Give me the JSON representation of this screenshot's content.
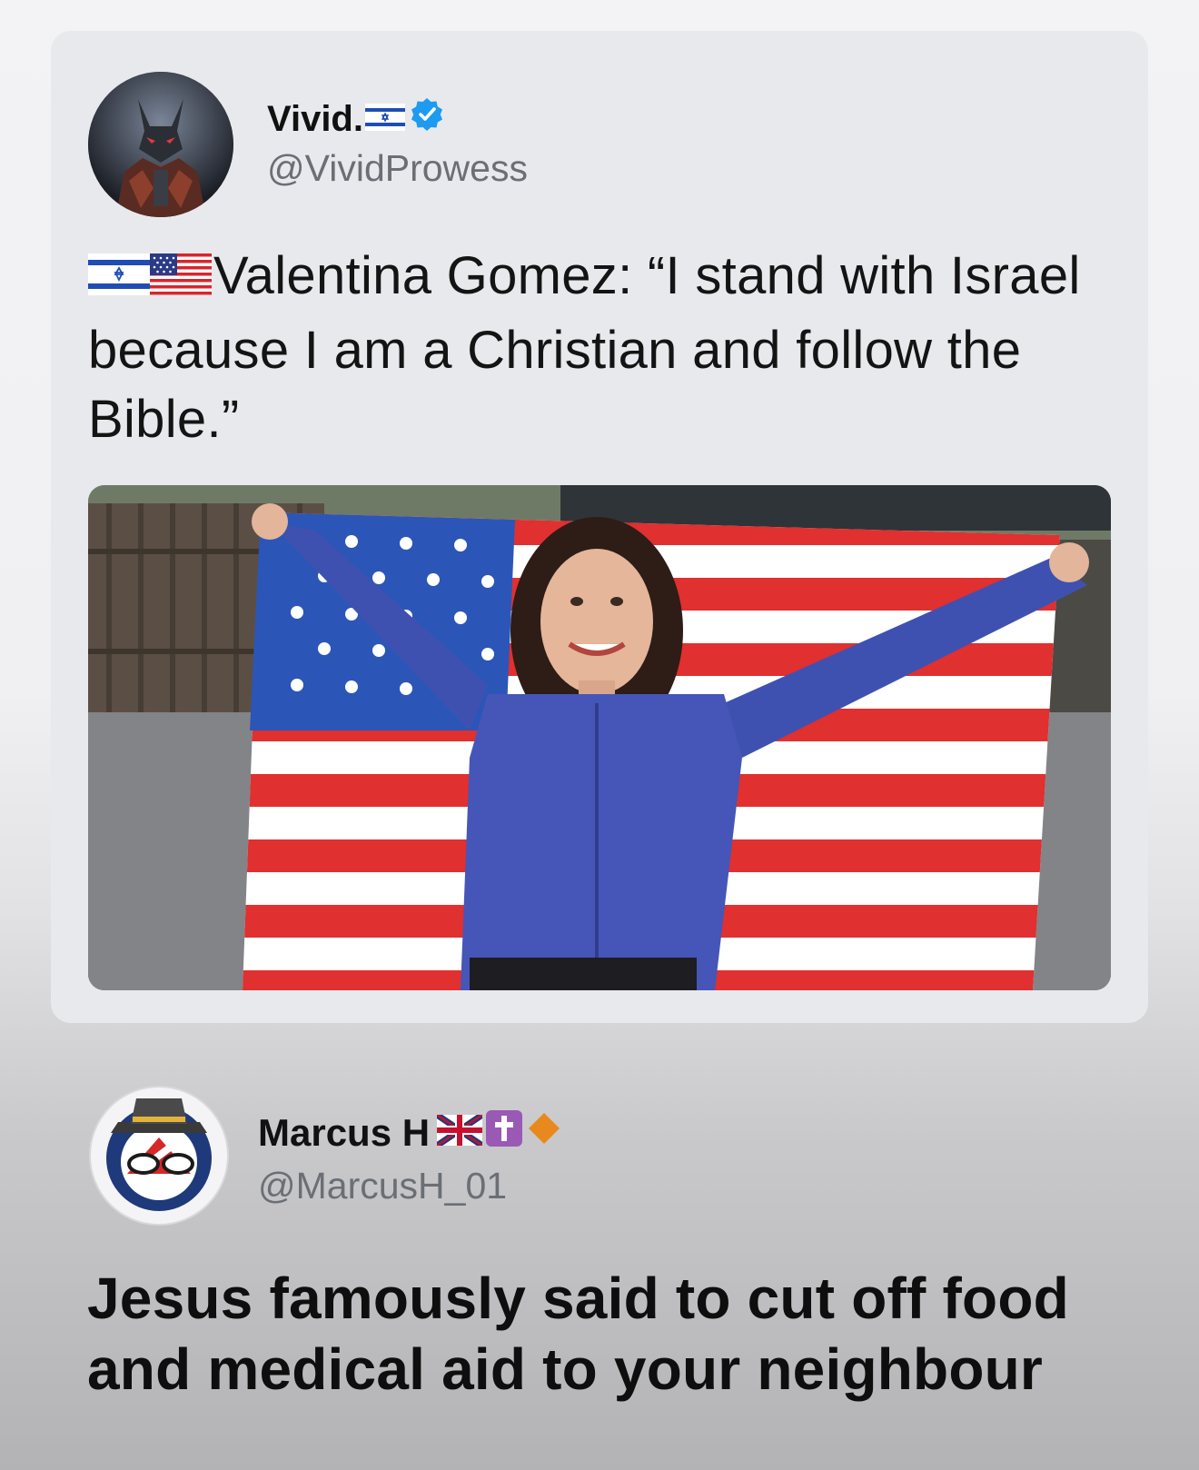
{
  "quoted_post": {
    "display_name": "Vivid.",
    "handle": "@VividProwess",
    "verified": true,
    "name_flag_icon": "israel-flag-icon",
    "text": "Valentina Gomez: “I stand with Israel because I am a Christian and follow the Bible.”",
    "text_prefix_icons": [
      "israel-flag-icon",
      "us-flag-icon"
    ],
    "photo_alt": "woman-holding-us-flag-photo"
  },
  "reply_post": {
    "display_name": "Marcus H",
    "handle": "@MarcusH_01",
    "name_icons": [
      "uk-flag-icon",
      "latin-cross-icon",
      "orange-diamond-icon"
    ],
    "text": "Jesus famously said to cut off food and medical aid to your neighbour"
  },
  "colors": {
    "verified_blue": "#1d9bf0",
    "cross_purple": "#9b59b6",
    "diamond_orange": "#e8891e"
  }
}
